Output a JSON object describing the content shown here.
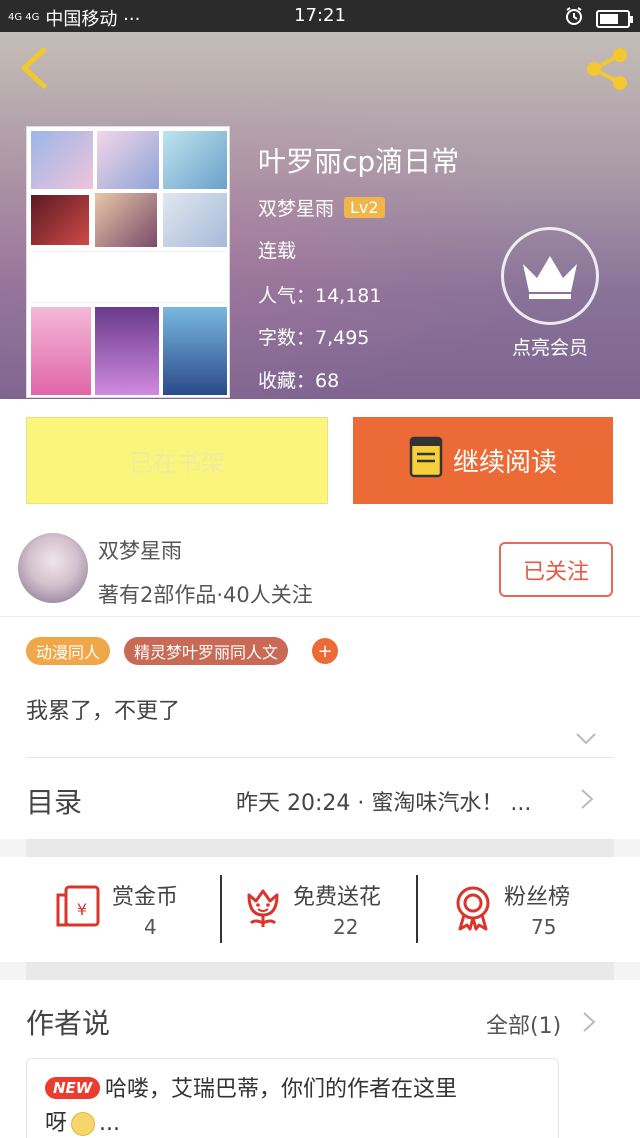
{
  "status_bar": {
    "signal": "4G 4G",
    "carrier": "中国移动 ···",
    "time": "17:21"
  },
  "book": {
    "title": "叶罗丽cp滴日常",
    "author": "双梦星雨",
    "level": "Lv2",
    "status": "连载",
    "popularity": "人气：14,181",
    "word_count": "字数：7,495",
    "favorites": "收藏：68",
    "vip_label": "点亮会员"
  },
  "actions": {
    "shelf_label": "已在书架",
    "read_label": "继续阅读"
  },
  "author_card": {
    "name": "双梦星雨",
    "stats": "著有2部作品·40人关注",
    "follow_label": "已关注"
  },
  "tags": [
    {
      "label": "动漫同人",
      "color": "#f0a74a"
    },
    {
      "label": "精灵梦叶罗丽同人文",
      "color": "#c86a55"
    }
  ],
  "tag_add": "+",
  "description": "我累了，不更了",
  "toc": {
    "label": "目录",
    "latest": "昨天 20:24 · 蜜淘味汽水！ ..."
  },
  "stats": [
    {
      "label": "赏金币",
      "value": "4",
      "icon": "red-envelope-icon"
    },
    {
      "label": "免费送花",
      "value": "22",
      "icon": "flower-icon"
    },
    {
      "label": "粉丝榜",
      "value": "75",
      "icon": "medal-icon"
    }
  ],
  "author_says": {
    "title": "作者说",
    "all_label": "全部(1)",
    "new_badge": "NEW",
    "text_line1": "哈喽，艾瑞巴蒂，你们的作者在这里",
    "text_line2": "呀",
    "text_tail": "..."
  },
  "colors": {
    "accent": "#ec6a35",
    "shelf": "#fbf57c",
    "level_badge": "#f0b64a",
    "follow": "#e35a45"
  }
}
